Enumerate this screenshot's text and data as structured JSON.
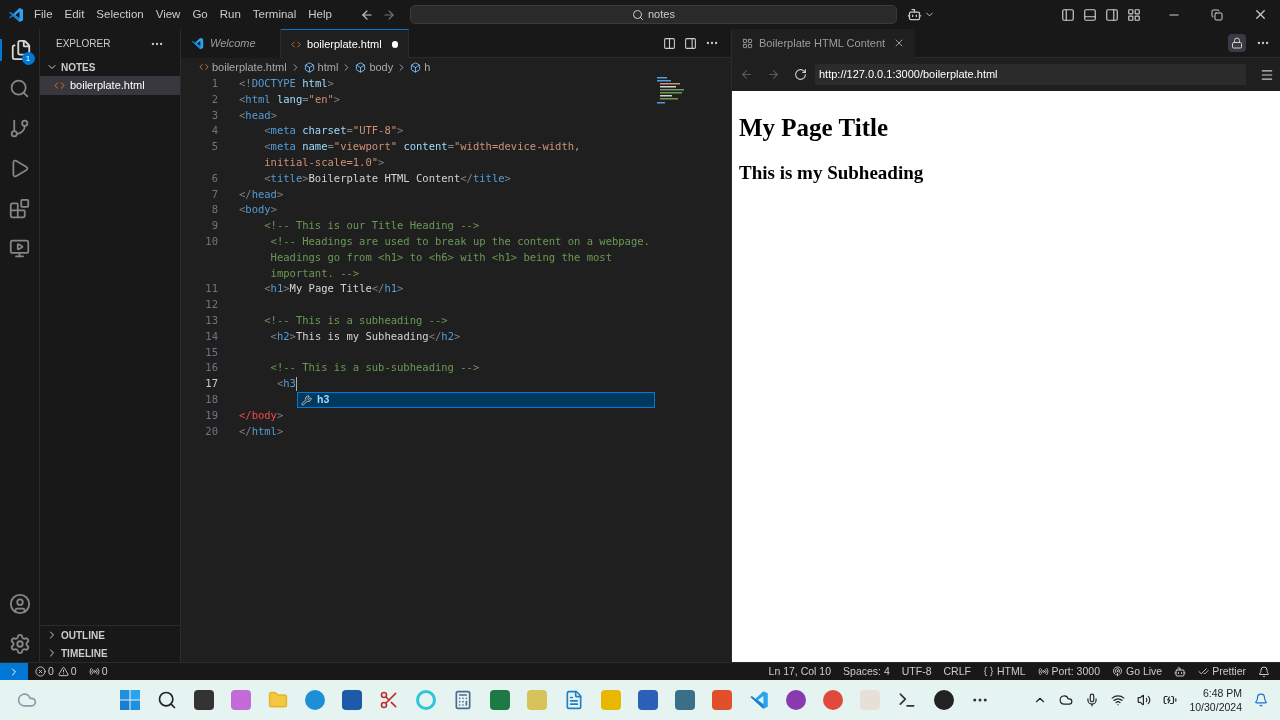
{
  "menu": [
    "File",
    "Edit",
    "Selection",
    "View",
    "Go",
    "Run",
    "Terminal",
    "Help"
  ],
  "command_center": {
    "value": "notes"
  },
  "activity_badge": "1",
  "sidebar": {
    "title": "EXPLORER",
    "folder": {
      "label": "NOTES",
      "expanded": true,
      "files": [
        {
          "name": "boilerplate.html",
          "selected": true
        }
      ]
    },
    "sections": [
      {
        "label": "OUTLINE",
        "expanded": false
      },
      {
        "label": "TIMELINE",
        "expanded": false
      }
    ]
  },
  "tabs": [
    {
      "label": "Welcome",
      "kind": "welcome",
      "selected": false,
      "modified": false
    },
    {
      "label": "boilerplate.html",
      "kind": "html",
      "selected": true,
      "modified": true
    }
  ],
  "breadcrumb": [
    {
      "label": "boilerplate.html",
      "kind": "file"
    },
    {
      "label": "html",
      "kind": "element"
    },
    {
      "label": "body",
      "kind": "element"
    },
    {
      "label": "h",
      "kind": "element"
    }
  ],
  "code": [
    {
      "number": "1",
      "tokens": [
        {
          "kind": "bracket",
          "text": "<!"
        },
        {
          "kind": "tag",
          "text": "DOCTYPE"
        },
        {
          "kind": "attr",
          "text": " html"
        },
        {
          "kind": "bracket",
          "text": ">"
        }
      ]
    },
    {
      "number": "2",
      "tokens": [
        {
          "kind": "bracket",
          "text": "<"
        },
        {
          "kind": "tag",
          "text": "html"
        },
        {
          "kind": "attr",
          "text": " lang"
        },
        {
          "kind": "bracket",
          "text": "="
        },
        {
          "kind": "string",
          "text": "\"en\""
        },
        {
          "kind": "bracket",
          "text": ">"
        }
      ]
    },
    {
      "number": "3",
      "tokens": [
        {
          "kind": "bracket",
          "text": "<"
        },
        {
          "kind": "tag",
          "text": "head"
        },
        {
          "kind": "bracket",
          "text": ">"
        }
      ]
    },
    {
      "number": "4",
      "tokens": [
        {
          "kind": "bracket",
          "text": "    <"
        },
        {
          "kind": "tag",
          "text": "meta"
        },
        {
          "kind": "attr",
          "text": " charset"
        },
        {
          "kind": "bracket",
          "text": "="
        },
        {
          "kind": "string",
          "text": "\"UTF-8\""
        },
        {
          "kind": "bracket",
          "text": ">"
        }
      ]
    },
    {
      "number": "5",
      "tokens": [
        {
          "kind": "bracket",
          "text": "    <"
        },
        {
          "kind": "tag",
          "text": "meta"
        },
        {
          "kind": "attr",
          "text": " name"
        },
        {
          "kind": "bracket",
          "text": "="
        },
        {
          "kind": "string",
          "text": "\"viewport\""
        },
        {
          "kind": "attr",
          "text": " content"
        },
        {
          "kind": "bracket",
          "text": "="
        },
        {
          "kind": "string",
          "text": "\"width=device-width,"
        }
      ]
    },
    {
      "tokens": [
        {
          "kind": "string",
          "text": "    initial-scale=1.0\""
        },
        {
          "kind": "bracket",
          "text": ">"
        }
      ]
    },
    {
      "number": "6",
      "tokens": [
        {
          "kind": "bracket",
          "text": "    <"
        },
        {
          "kind": "tag",
          "text": "title"
        },
        {
          "kind": "bracket",
          "text": ">"
        },
        {
          "kind": "text",
          "text": "Boilerplate HTML Content"
        },
        {
          "kind": "bracket",
          "text": "</"
        },
        {
          "kind": "tag",
          "text": "title"
        },
        {
          "kind": "bracket",
          "text": ">"
        }
      ]
    },
    {
      "number": "7",
      "tokens": [
        {
          "kind": "bracket",
          "text": "</"
        },
        {
          "kind": "tag",
          "text": "head"
        },
        {
          "kind": "bracket",
          "text": ">"
        }
      ]
    },
    {
      "number": "8",
      "tokens": [
        {
          "kind": "bracket",
          "text": "<"
        },
        {
          "kind": "tag",
          "text": "body"
        },
        {
          "kind": "bracket",
          "text": ">"
        }
      ]
    },
    {
      "number": "9",
      "tokens": [
        {
          "kind": "comment",
          "text": "    <!-- This is our Title Heading -->"
        }
      ]
    },
    {
      "number": "10",
      "tokens": [
        {
          "kind": "comment",
          "text": "     <!-- Headings are used to break up the content on a webpage."
        }
      ]
    },
    {
      "tokens": [
        {
          "kind": "comment",
          "text": "     Headings go from <h1> to <h6> with <h1> being the most"
        }
      ]
    },
    {
      "tokens": [
        {
          "kind": "comment",
          "text": "     important. -->"
        }
      ]
    },
    {
      "number": "11",
      "tokens": [
        {
          "kind": "bracket",
          "text": "    <"
        },
        {
          "kind": "tag",
          "text": "h1"
        },
        {
          "kind": "bracket",
          "text": ">"
        },
        {
          "kind": "text",
          "text": "My Page Title"
        },
        {
          "kind": "bracket",
          "text": "</"
        },
        {
          "kind": "tag",
          "text": "h1"
        },
        {
          "kind": "bracket",
          "text": ">"
        }
      ]
    },
    {
      "number": "12"
    },
    {
      "number": "13",
      "tokens": [
        {
          "kind": "comment",
          "text": "    <!-- This is a subheading -->"
        }
      ]
    },
    {
      "number": "14",
      "tokens": [
        {
          "kind": "bracket",
          "text": "     <"
        },
        {
          "kind": "tag",
          "text": "h2"
        },
        {
          "kind": "bracket",
          "text": ">"
        },
        {
          "kind": "text",
          "text": "This is my Subheading"
        },
        {
          "kind": "bracket",
          "text": "</"
        },
        {
          "kind": "tag",
          "text": "h2"
        },
        {
          "kind": "bracket",
          "text": ">"
        }
      ]
    },
    {
      "number": "15"
    },
    {
      "number": "16",
      "tokens": [
        {
          "kind": "comment",
          "text": "     <!-- This is a sub-subheading -->"
        }
      ]
    },
    {
      "number": "17",
      "current": true,
      "tokens": [
        {
          "kind": "bracket",
          "text": "      <"
        },
        {
          "kind": "tag",
          "text": "h3"
        }
      ],
      "suggestion": "h3"
    },
    {
      "number": "18"
    },
    {
      "number": "19",
      "tokens": [
        {
          "kind": "error",
          "text": "</body"
        },
        {
          "kind": "bracket",
          "text": ">"
        }
      ]
    },
    {
      "number": "20",
      "tokens": [
        {
          "kind": "bracket",
          "text": "</"
        },
        {
          "kind": "tag",
          "text": "html"
        },
        {
          "kind": "bracket",
          "text": ">"
        }
      ]
    }
  ],
  "preview": {
    "tab": "Boilerplate HTML Content",
    "url": "http://127.0.0.1:3000/boilerplate.html",
    "h1": "My Page Title",
    "h2": "This is my Subheading"
  },
  "status_bar": {
    "errors": "0",
    "warnings": "0",
    "ports": "0",
    "right": [
      {
        "kind": "text",
        "label": "Ln 17, Col 10"
      },
      {
        "kind": "text",
        "label": "Spaces: 4"
      },
      {
        "kind": "text",
        "label": "UTF-8"
      },
      {
        "kind": "text",
        "label": "CRLF"
      },
      {
        "kind": "language",
        "label": "HTML"
      },
      {
        "kind": "port",
        "label": "Port: 3000"
      },
      {
        "kind": "live",
        "label": "Go Live"
      },
      {
        "kind": "copilot"
      },
      {
        "kind": "prettier",
        "label": "Prettier"
      },
      {
        "kind": "bell"
      }
    ]
  },
  "taskbar": {
    "time": "6:48 PM",
    "date": "10/30/2024"
  }
}
